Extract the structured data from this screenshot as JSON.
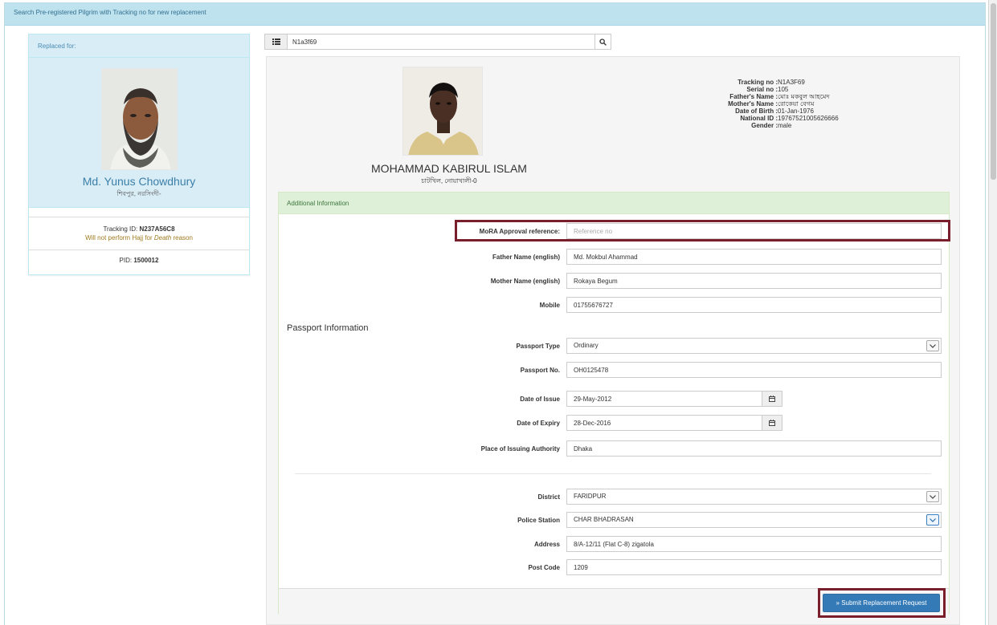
{
  "header": {
    "title": "Search Pre-registered Pilgrim with Tracking no for new replacement"
  },
  "search": {
    "value": "N1a3f69",
    "list_icon": "list-icon",
    "search_icon": "search-icon"
  },
  "replaced_card": {
    "heading": "Replaced for:",
    "name": "Md. Yunus Chowdhury",
    "address": "শিবপুর, নরসিংদী-",
    "tracking_label": "Tracking ID: ",
    "tracking_value": "N237A56C8",
    "reason_prefix": "Will not perform Hajj for ",
    "reason_value": "Death",
    "reason_suffix": " reason",
    "pid_label": "PID: ",
    "pid_value": "1500012"
  },
  "pilgrim": {
    "name": "MOHAMMAD KABIRUL ISLAM",
    "address": "চাটখিল, নোয়াখালী-0",
    "info": [
      {
        "label": "Tracking no :",
        "value": "N1A3F69"
      },
      {
        "label": "Serial no :",
        "value": "105"
      },
      {
        "label": "Father's Name :",
        "value": "মোঃ মকবুল আহমেদ"
      },
      {
        "label": "Mother's Name :",
        "value": "রোকেয়া বেগম"
      },
      {
        "label": "Date of Birth :",
        "value": "01-Jan-1976"
      },
      {
        "label": "National ID :",
        "value": "19767521005626666"
      },
      {
        "label": "Gender :",
        "value": "male"
      }
    ]
  },
  "form": {
    "panel_heading": "Additional Information",
    "mora_label": "MoRA Approval reference:",
    "mora_placeholder": "Reference no",
    "father_label": "Father Name (english)",
    "father_value": "Md. Mokbul Ahammad",
    "mother_label": "Mother Name (english)",
    "mother_value": "Rokaya Begum",
    "mobile_label": "Mobile",
    "mobile_value": "01755676727",
    "passport_section": "Passport Information",
    "passport_type_label": "Passport Type",
    "passport_type_value": "Ordinary",
    "passport_no_label": "Passport No.",
    "passport_no_value": "OH0125478",
    "issue_label": "Date of Issue",
    "issue_value": "29-May-2012",
    "expiry_label": "Date of Expiry",
    "expiry_value": "28-Dec-2016",
    "authority_label": "Place of Issuing Authority",
    "authority_value": "Dhaka",
    "district_label": "District",
    "district_value": "FARIDPUR",
    "police_label": "Police Station",
    "police_value": "CHAR BHADRASAN",
    "address_label": "Address",
    "address_value": "8/A-12/11 (Flat C-8) zigatola",
    "postcode_label": "Post Code",
    "postcode_value": "1209",
    "submit_label": "» Submit Replacement Request"
  },
  "colors": {
    "header_bg": "#bfe2ef",
    "info_panel_bg": "#d9edf7",
    "success_panel_bg": "#dff0d8",
    "primary_button": "#337ab7",
    "highlight_border": "#7a1e2c"
  }
}
